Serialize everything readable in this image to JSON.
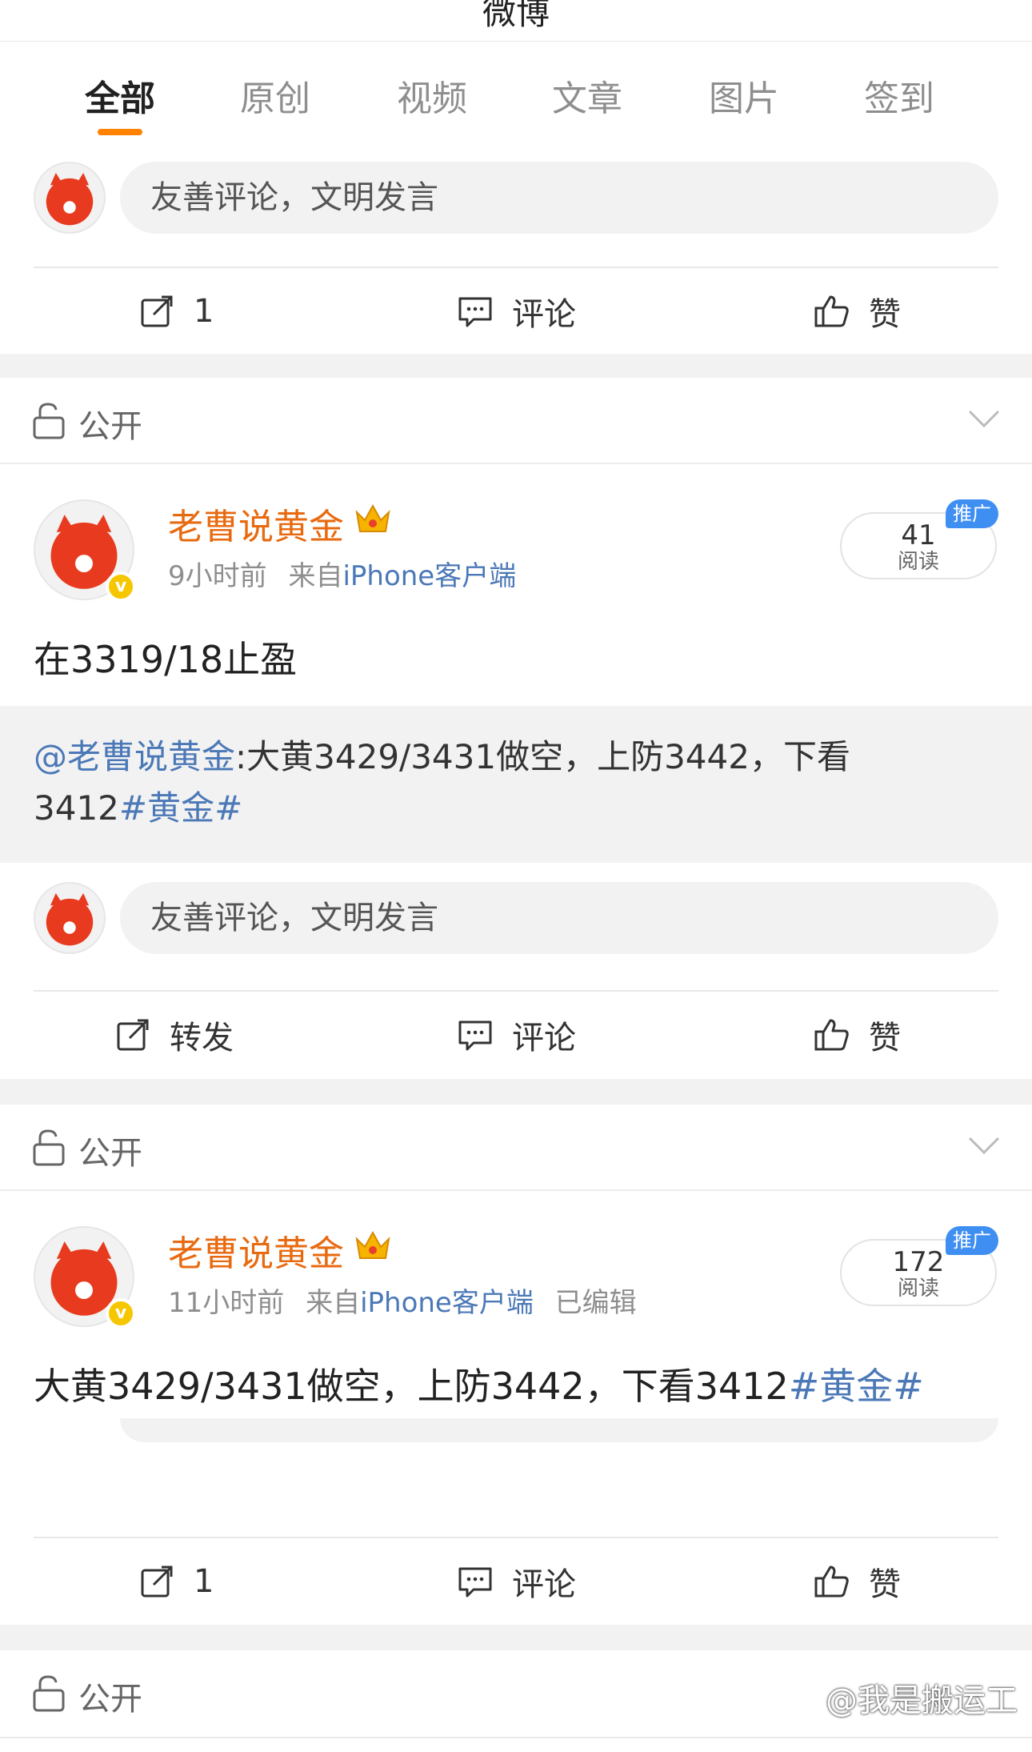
{
  "header": {
    "title": "微博"
  },
  "tabs": [
    {
      "label": "全部"
    },
    {
      "label": "原创"
    },
    {
      "label": "视频"
    },
    {
      "label": "文章"
    },
    {
      "label": "图片"
    },
    {
      "label": "签到"
    }
  ],
  "comment_placeholder": "友善评论，文明发言",
  "actions": {
    "repost_count": "1",
    "repost_label": "转发",
    "comment_label": "评论",
    "like_label": "赞"
  },
  "visibility_label": "公开",
  "posts": [
    {
      "author": "老曹说黄金",
      "time": "9小时前",
      "from_prefix": "来自",
      "source": "iPhone客户端",
      "edited": "",
      "reads": "41",
      "reads_label": "阅读",
      "promo_badge": "推广",
      "text": "在3319/18止盈",
      "quote_mention": "@老曹说黄金",
      "quote_text_1": ":大黄3429/3431做空，上防3442，下看",
      "quote_text_2": "3412",
      "quote_tag": "#黄金#"
    },
    {
      "author": "老曹说黄金",
      "time": "11小时前",
      "from_prefix": "来自",
      "source": "iPhone客户端",
      "edited": "已编辑",
      "reads": "172",
      "reads_label": "阅读",
      "promo_badge": "推广",
      "text": "大黄3429/3431做空，上防3442，下看3412",
      "tag": "#黄金#"
    }
  ],
  "watermark": "@我是搬运工",
  "colors": {
    "accent": "#ff8200",
    "username": "#e86a10",
    "link": "#4b78b7",
    "promo": "#3f8ff3",
    "vip": "#f6c700"
  }
}
